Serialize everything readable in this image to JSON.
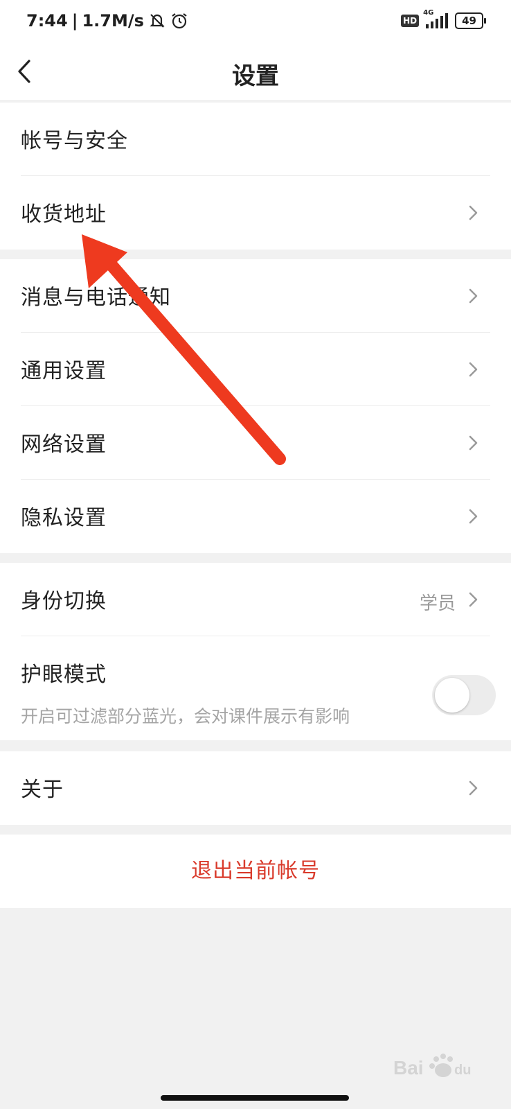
{
  "status_bar": {
    "time": "7:44",
    "speed": "1.7M/s",
    "hd_badge": "HD",
    "network": "4G",
    "battery": "49"
  },
  "header": {
    "title": "设置"
  },
  "groups": {
    "account": [
      {
        "label": "帐号与安全"
      },
      {
        "label": "收货地址"
      }
    ],
    "settings": [
      {
        "label": "消息与电话通知"
      },
      {
        "label": "通用设置"
      },
      {
        "label": "网络设置"
      },
      {
        "label": "隐私设置"
      }
    ],
    "identity": {
      "switch_label": "身份切换",
      "switch_value": "学员",
      "eye_label": "护眼模式",
      "eye_sub": "开启可过滤部分蓝光，会对课件展示有影响",
      "eye_on": false
    },
    "about": {
      "label": "关于"
    },
    "logout": {
      "label": "退出当前帐号"
    }
  },
  "icons": [
    "back-arrow-icon",
    "chevron-right-icon",
    "mute-icon",
    "alarm-icon"
  ],
  "annotation_color": "#ee3a1f",
  "accent_red": "#d93a2b"
}
